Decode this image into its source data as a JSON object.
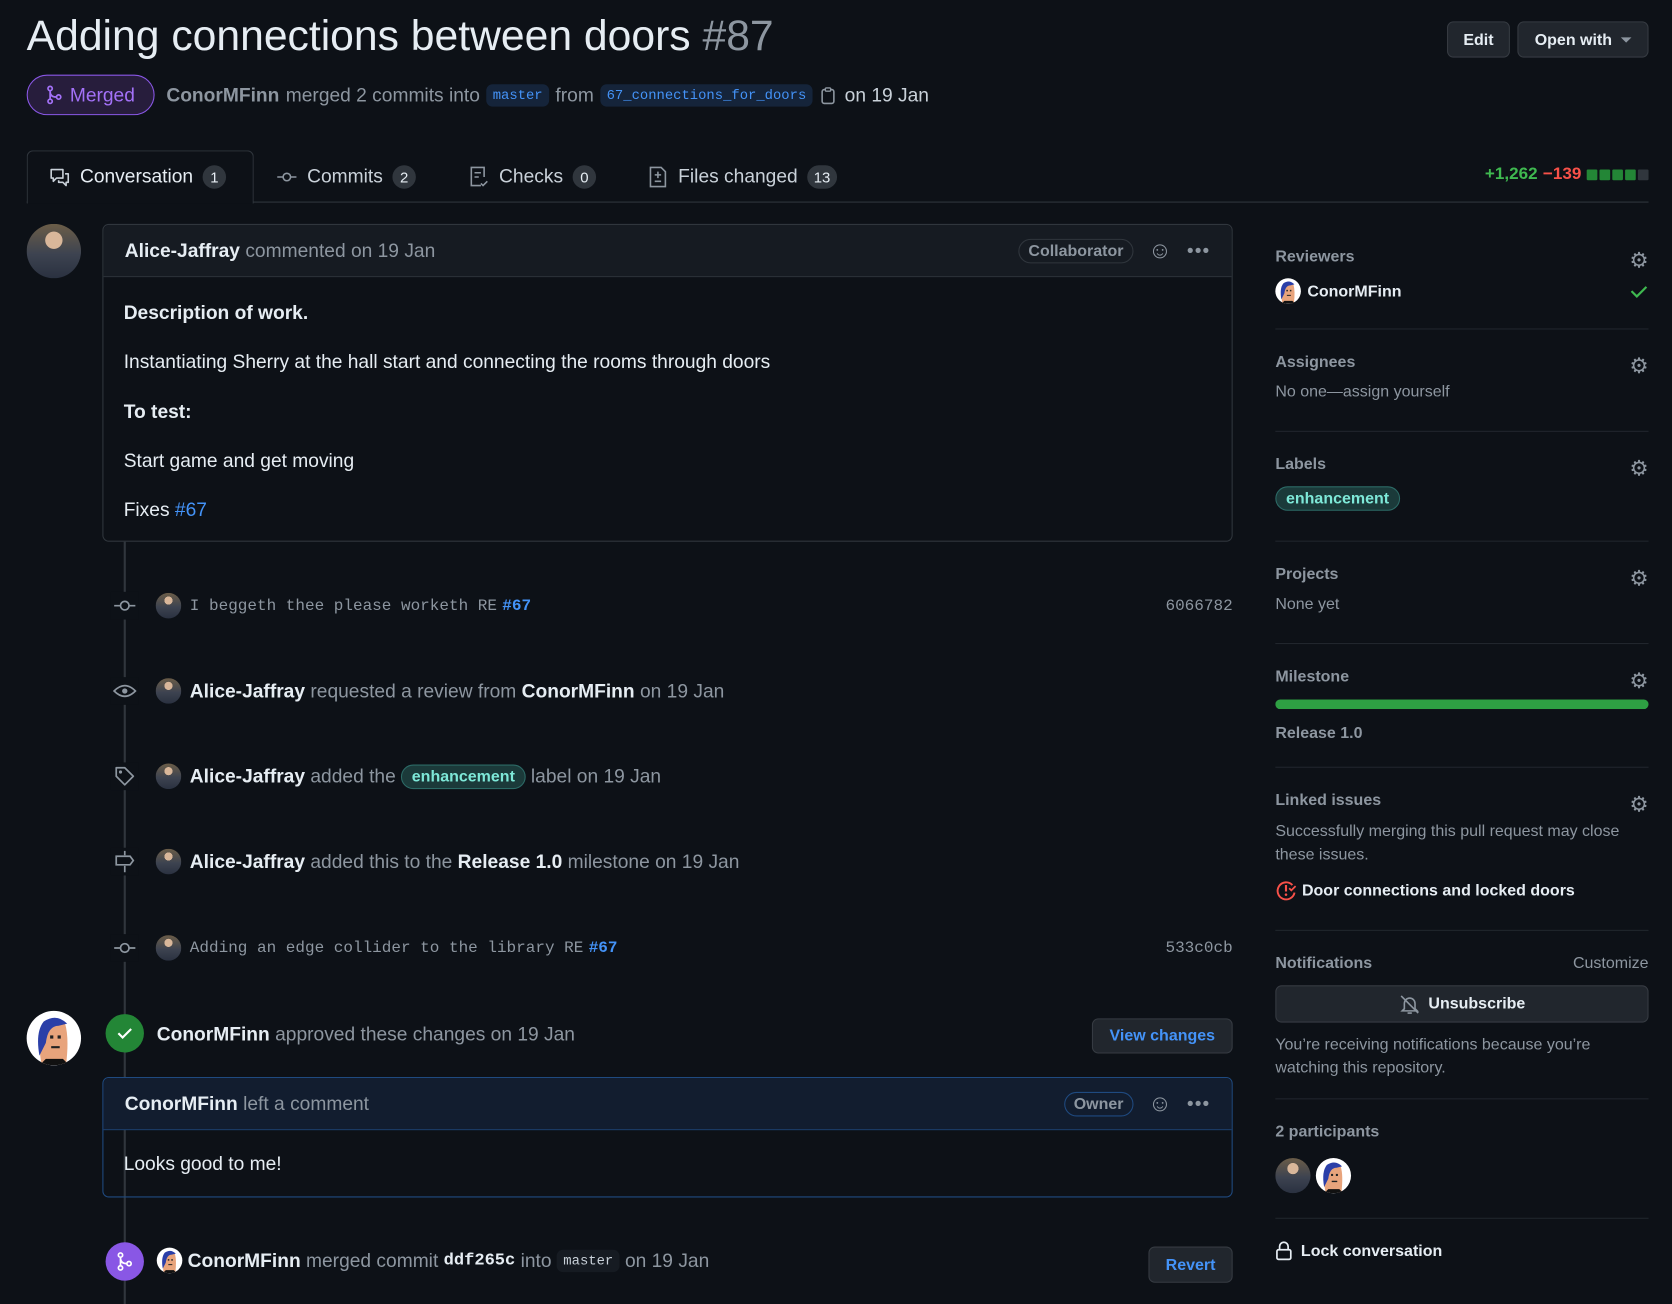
{
  "header": {
    "title": "Adding connections between doors",
    "number": "#87",
    "edit_label": "Edit",
    "open_with_label": "Open with",
    "state": "Merged",
    "author": "ConorMFinn",
    "merged_text": "merged 2 commits into",
    "base_branch": "master",
    "from_text": "from",
    "head_branch": "67_connections_for_doors",
    "date": "on 19 Jan"
  },
  "tabs": [
    {
      "label": "Conversation",
      "count": "1"
    },
    {
      "label": "Commits",
      "count": "2"
    },
    {
      "label": "Checks",
      "count": "0"
    },
    {
      "label": "Files changed",
      "count": "13"
    }
  ],
  "diffstat": {
    "additions": "+1,262",
    "deletions": "−139",
    "blocks_green": 4,
    "blocks_total": 5
  },
  "comment1": {
    "author": "Alice-Jaffray",
    "action": "commented on 19 Jan",
    "role": "Collaborator",
    "heading1": "Description of work.",
    "para1": "Instantiating Sherry at the hall start and connecting the rooms through doors",
    "heading2": "To test:",
    "para2": "Start game and get moving",
    "fixes": "Fixes",
    "fixes_link": "#67"
  },
  "timeline": {
    "commit1": {
      "message": "I beggeth thee please worketh RE",
      "ref": "#67",
      "sha": "6066782"
    },
    "review_request": {
      "actor": "Alice-Jaffray",
      "text": "requested a review from",
      "target": "ConorMFinn",
      "date": "on 19 Jan"
    },
    "labeled": {
      "actor": "Alice-Jaffray",
      "text1": "added the",
      "label": "enhancement",
      "text2": "label on 19 Jan"
    },
    "milestoned": {
      "actor": "Alice-Jaffray",
      "text1": "added this to the",
      "milestone": "Release 1.0",
      "text2": "milestone on 19 Jan"
    },
    "commit2": {
      "message": "Adding an edge collider to the library RE",
      "ref": "#67",
      "sha": "533c0cb"
    },
    "approved": {
      "actor": "ConorMFinn",
      "text": "approved these changes on 19 Jan",
      "button": "View changes"
    },
    "review_comment": {
      "author": "ConorMFinn",
      "action": "left a comment",
      "role": "Owner",
      "body": "Looks good to me!"
    },
    "merged": {
      "actor": "ConorMFinn",
      "text1": "merged commit",
      "sha": "ddf265c",
      "text2": "into",
      "branch": "master",
      "date": "on 19 Jan",
      "button": "Revert"
    }
  },
  "sidebar": {
    "reviewers": {
      "title": "Reviewers",
      "name": "ConorMFinn"
    },
    "assignees": {
      "title": "Assignees",
      "text": "No one—assign yourself"
    },
    "labels": {
      "title": "Labels",
      "label": "enhancement"
    },
    "projects": {
      "title": "Projects",
      "text": "None yet"
    },
    "milestone": {
      "title": "Milestone",
      "progress": 1.0,
      "name": "Release 1.0"
    },
    "linked": {
      "title": "Linked issues",
      "text": "Successfully merging this pull request may close these issues.",
      "issue": "Door connections and locked doors"
    },
    "notifications": {
      "title": "Notifications",
      "customize": "Customize",
      "button": "Unsubscribe",
      "text": "You’re receiving notifications because you’re watching this repository."
    },
    "participants": {
      "title": "2 participants"
    },
    "lock": "Lock conversation"
  },
  "colors": {
    "bg": "#0d1117",
    "merged": "#8957e5",
    "approved": "#238636",
    "link": "#4493f8",
    "add": "#3fb950",
    "del": "#f85149"
  }
}
